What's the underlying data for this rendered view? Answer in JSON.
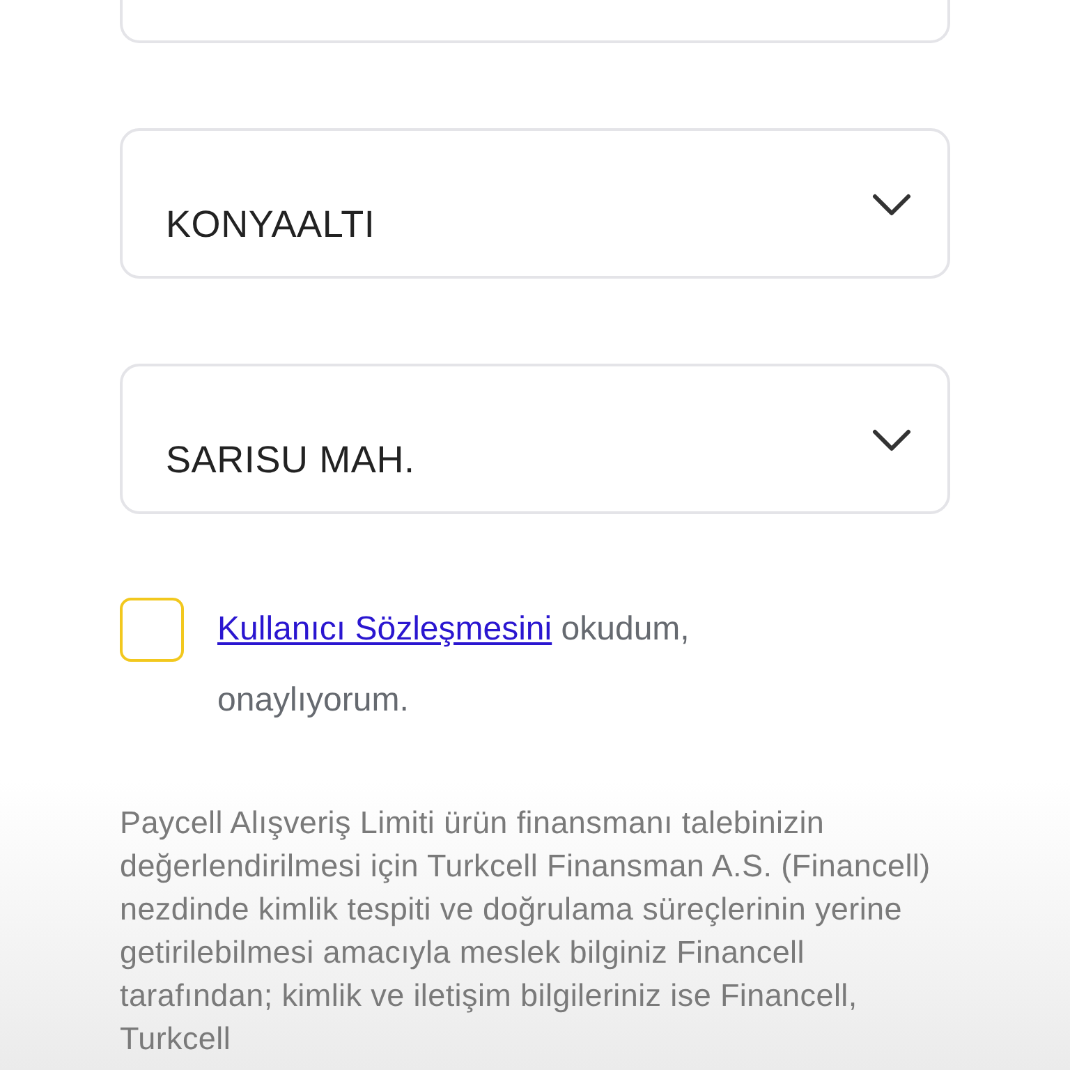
{
  "dropdowns": [
    {
      "value": "KONYAALTI"
    },
    {
      "value": "SARISU MAH."
    }
  ],
  "agreement": {
    "checked": false,
    "link": "Kullanıcı Sözleşmesini",
    "text": "okudum, onaylıyorum."
  },
  "disclosure": "Paycell Alışveriş Limiti ürün finansmanı talebinizin değerlendirilmesi için Turkcell Finansman A.S. (Financell) nezdinde kimlik tespiti ve doğrulama süreçlerinin yerine getirilebilmesi amacıyla meslek bilginiz Financell tarafından; kimlik ve iletişim bilgileriniz ise Financell, Turkcell"
}
